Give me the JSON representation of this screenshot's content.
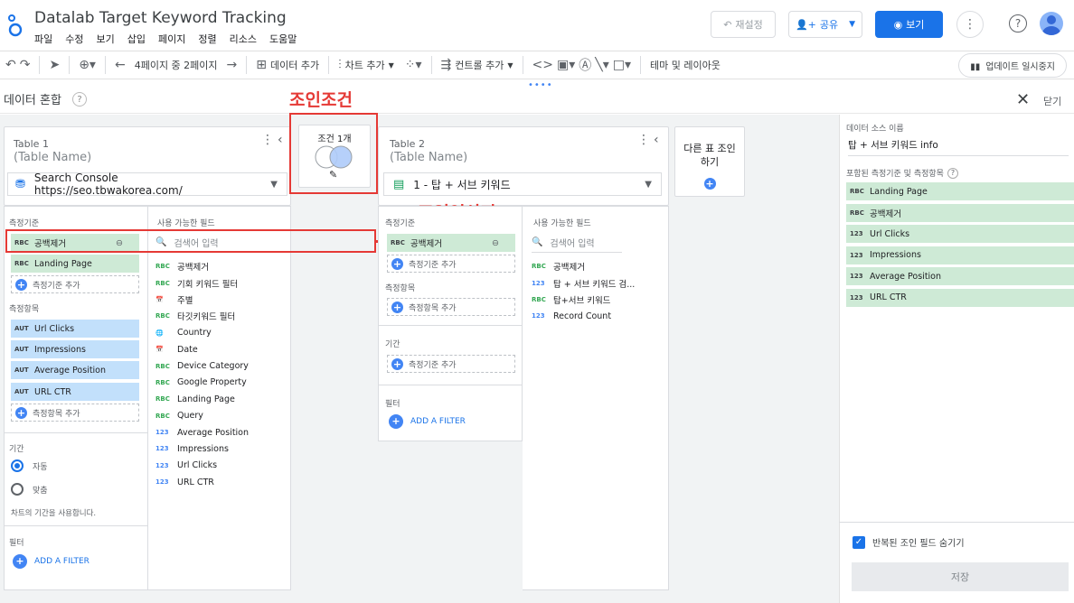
{
  "app": {
    "title": "Datalab Target Keyword Tracking",
    "menu": [
      "파일",
      "수정",
      "보기",
      "삽입",
      "페이지",
      "정렬",
      "리소스",
      "도움말"
    ],
    "reset_label": "재설정",
    "share_label": "공유",
    "view_label": "보기"
  },
  "toolbar": {
    "page_indicator": "4페이지 중 2페이지",
    "add_data": "데이터 추가",
    "add_chart": "차트 추가",
    "add_control": "컨트롤 추가",
    "theme_layout": "테마 및 레이아웃",
    "pause_updates": "업데이트 일시중지"
  },
  "blend": {
    "title": "데이터 혼합",
    "close_label": "닫기"
  },
  "annotations": {
    "join_condition": "조인조건",
    "join_operator": "조인연산자"
  },
  "join": {
    "condition_label": "조건 1개"
  },
  "other_join": "다른 표 조인 하기",
  "table1": {
    "label": "Table 1",
    "name": "(Table Name)",
    "source": "Search Console https://seo.tbwakorea.com/",
    "dimensions_header": "측정기준",
    "dimensions": [
      {
        "type": "RBC",
        "name": "공백제거"
      },
      {
        "type": "RBC",
        "name": "Landing Page"
      }
    ],
    "add_dimension": "측정기준 추가",
    "metrics_header": "측정항목",
    "metrics": [
      {
        "type": "AUT",
        "name": "Url Clicks"
      },
      {
        "type": "AUT",
        "name": "Impressions"
      },
      {
        "type": "AUT",
        "name": "Average Position"
      },
      {
        "type": "AUT",
        "name": "URL CTR"
      }
    ],
    "add_metric": "측정항목 추가",
    "date_header": "기간",
    "date_auto": "자동",
    "date_custom": "맞춤",
    "date_note": "차트의 기간을 사용합니다.",
    "filter_header": "필터",
    "add_filter": "ADD A FILTER",
    "available_header": "사용 가능한 필드",
    "search_placeholder": "검색어 입력",
    "available": [
      {
        "type": "RBC",
        "name": "공백제거",
        "numeric": false
      },
      {
        "type": "RBC",
        "name": "기회 키워드 필터",
        "numeric": false
      },
      {
        "type": "📅",
        "name": "주별",
        "numeric": false
      },
      {
        "type": "RBC",
        "name": "타깃키워드 필터",
        "numeric": false
      },
      {
        "type": "🌐",
        "name": "Country",
        "numeric": false
      },
      {
        "type": "📅",
        "name": "Date",
        "numeric": false
      },
      {
        "type": "RBC",
        "name": "Device Category",
        "numeric": false
      },
      {
        "type": "RBC",
        "name": "Google Property",
        "numeric": false
      },
      {
        "type": "RBC",
        "name": "Landing Page",
        "numeric": false
      },
      {
        "type": "RBC",
        "name": "Query",
        "numeric": false
      },
      {
        "type": "123",
        "name": "Average Position",
        "numeric": true
      },
      {
        "type": "123",
        "name": "Impressions",
        "numeric": true
      },
      {
        "type": "123",
        "name": "Url Clicks",
        "numeric": true
      },
      {
        "type": "123",
        "name": "URL CTR",
        "numeric": true
      }
    ]
  },
  "table2": {
    "label": "Table 2",
    "name": "(Table Name)",
    "source": "1 - 탑 + 서브 키워드",
    "dimensions_header": "측정기준",
    "dimensions": [
      {
        "type": "RBC",
        "name": "공백제거"
      }
    ],
    "add_dimension": "측정기준 추가",
    "metrics_header": "측정항목",
    "add_metric": "측정항목 추가",
    "date_header": "기간",
    "add_date": "측정기준 추가",
    "filter_header": "필터",
    "add_filter": "ADD A FILTER",
    "available_header": "사용 가능한 필드",
    "search_placeholder": "검색어 입력",
    "available": [
      {
        "type": "RBC",
        "name": "공백제거",
        "numeric": false
      },
      {
        "type": "123",
        "name": "탑 + 서브 키워드 검...",
        "numeric": true
      },
      {
        "type": "RBC",
        "name": "탑+서브 키워드",
        "numeric": false
      },
      {
        "type": "123",
        "name": "Record Count",
        "numeric": true
      }
    ]
  },
  "panel": {
    "source_name_label": "데이터 소스 이름",
    "source_name": "탑 + 서브 키워드 info",
    "included_label": "포함된 측정기준 및 측정항목",
    "fields": [
      {
        "type": "RBC",
        "name": "Landing Page"
      },
      {
        "type": "RBC",
        "name": "공백제거"
      },
      {
        "type": "123",
        "name": "Url Clicks"
      },
      {
        "type": "123",
        "name": "Impressions"
      },
      {
        "type": "123",
        "name": "Average Position"
      },
      {
        "type": "123",
        "name": "URL CTR"
      }
    ],
    "hide_repeated": "반복된 조인 필드 숨기기",
    "save_label": "저장"
  }
}
